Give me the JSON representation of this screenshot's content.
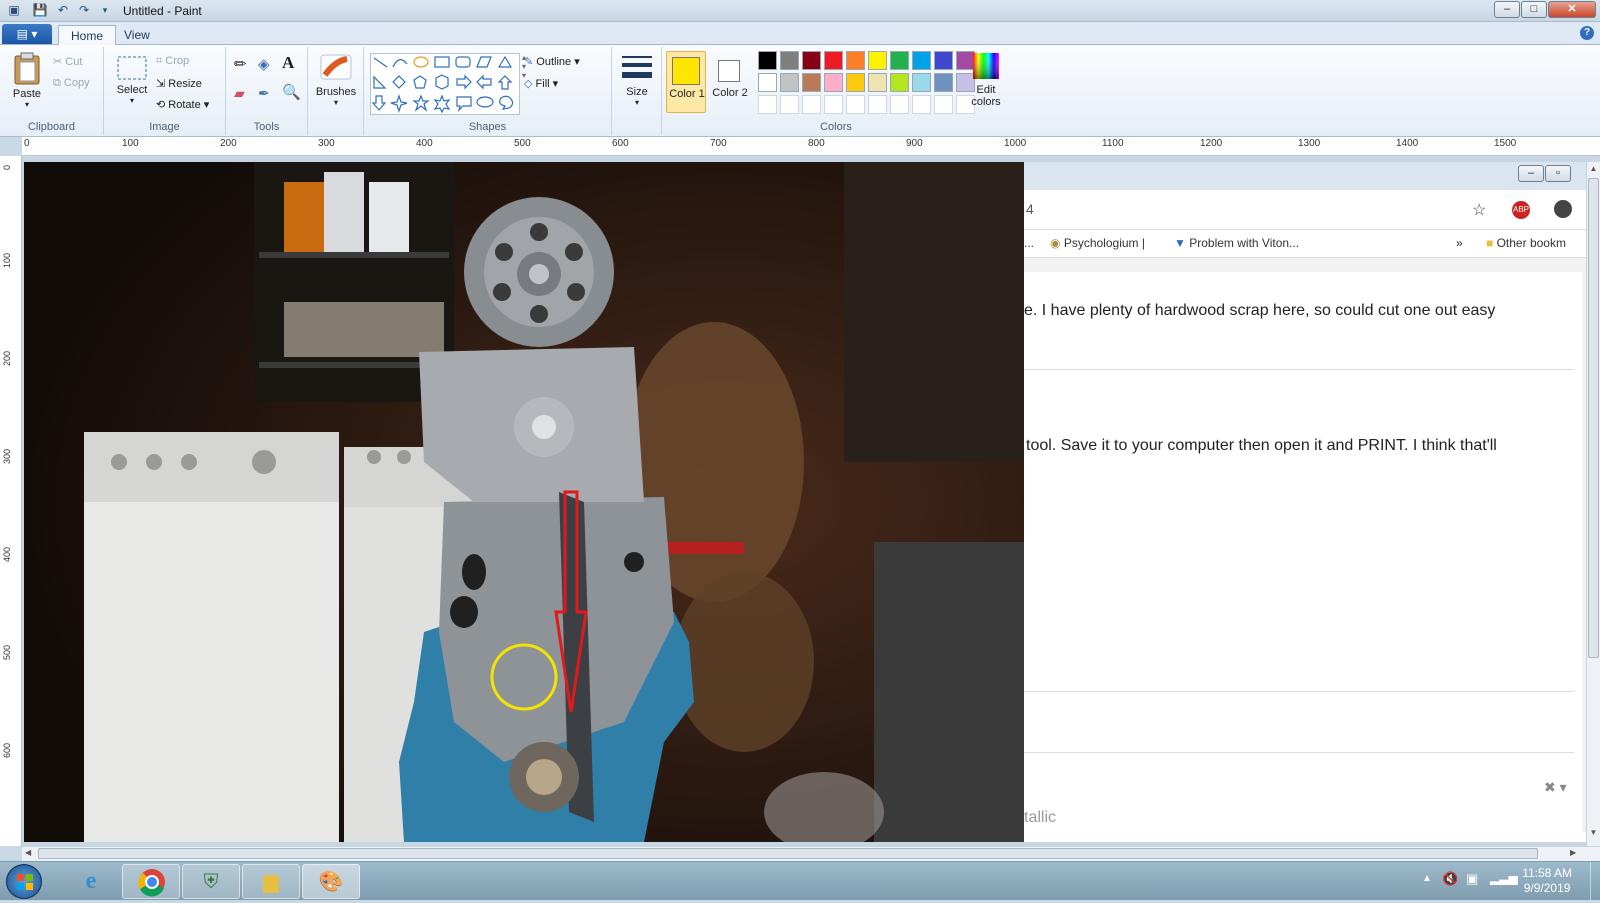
{
  "window": {
    "title": "Untitled - Paint",
    "minimize": "–",
    "maximize": "□",
    "close": "✕"
  },
  "ribbon": {
    "tabs": [
      "Home",
      "View"
    ],
    "clipboard": {
      "label": "Clipboard",
      "paste": "Paste",
      "cut": "Cut",
      "copy": "Copy"
    },
    "image": {
      "label": "Image",
      "select": "Select",
      "crop": "Crop",
      "resize": "Resize",
      "rotate": "Rotate"
    },
    "tools": {
      "label": "Tools"
    },
    "brushes": {
      "label": "Brushes"
    },
    "shapes": {
      "label": "Shapes",
      "outline": "Outline",
      "fill": "Fill"
    },
    "size": {
      "label": "Size"
    },
    "colors": {
      "label": "Colors",
      "color1": "Color 1",
      "color2": "Color 2",
      "color1_value": "#ffe600",
      "color2_value": "#ffffff",
      "edit": "Edit colors",
      "palette_row1": [
        "#000000",
        "#7f7f7f",
        "#880015",
        "#ed1c24",
        "#ff7f27",
        "#fff200",
        "#22b14c",
        "#00a2e8",
        "#3f48cc",
        "#a349a4"
      ],
      "palette_row2": [
        "#ffffff",
        "#c3c3c3",
        "#b97a57",
        "#ffaec9",
        "#ffc90e",
        "#efe4b0",
        "#b5e61d",
        "#99d9ea",
        "#7092be",
        "#c8bfe7"
      ]
    }
  },
  "ruler": {
    "horizontal": [
      "0",
      "100",
      "200",
      "300",
      "400",
      "500",
      "600",
      "700",
      "800",
      "900",
      "1000",
      "1100",
      "1200",
      "1300",
      "1400",
      "1500"
    ],
    "vertical": [
      "0",
      "100",
      "200",
      "300",
      "400",
      "500",
      "600"
    ]
  },
  "browser": {
    "tab_fragment": "4",
    "bookmarks": [
      "...",
      "Psychologium |",
      "Problem with Viton...",
      "»",
      "Other bookm"
    ],
    "line1": "e. I have plenty of hardwood scrap here, so could cut one out easy",
    "line2": "tool.  Save it to your computer then open it and PRINT.  I think that'll",
    "line3": "tallic"
  },
  "taskbar": {
    "time": "11:58 AM",
    "date": "9/9/2019"
  }
}
